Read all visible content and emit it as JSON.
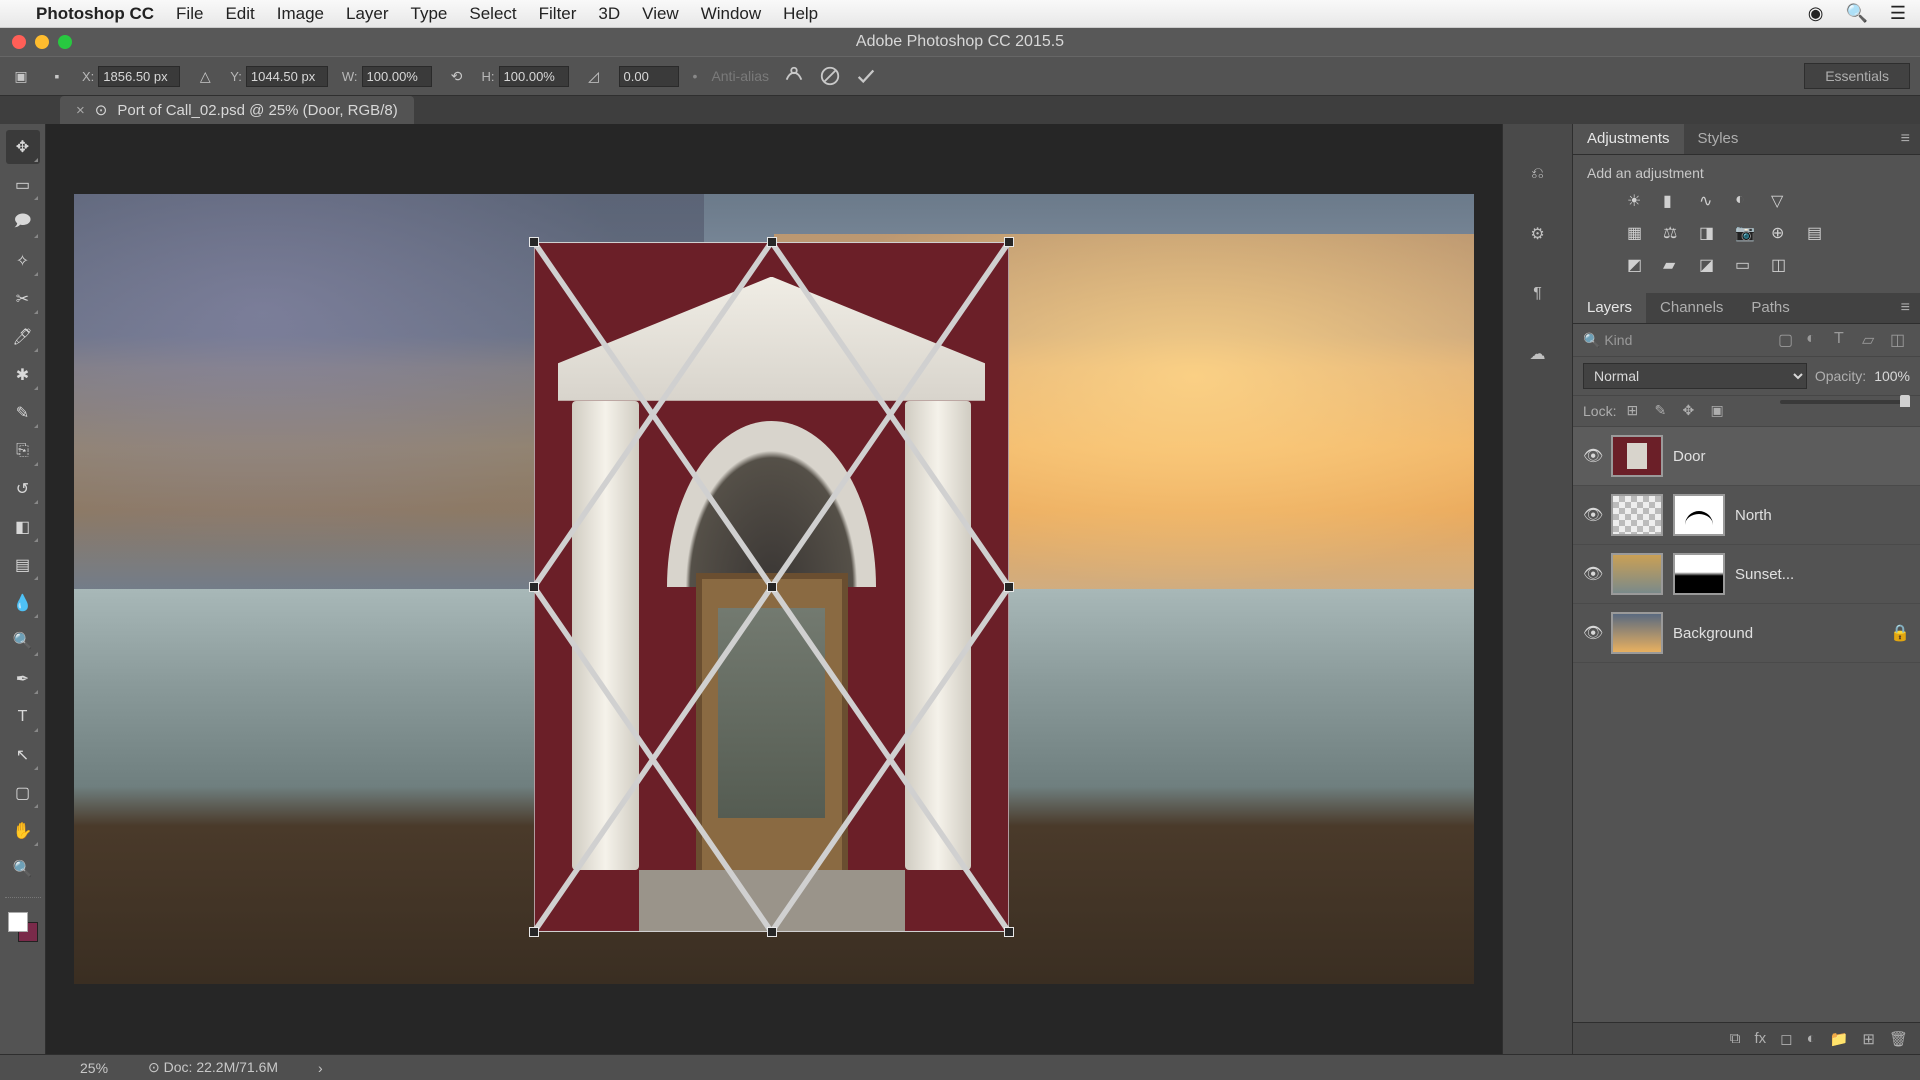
{
  "mac_menu": {
    "app_name": "Photoshop CC",
    "items": [
      "File",
      "Edit",
      "Image",
      "Layer",
      "Type",
      "Select",
      "Filter",
      "3D",
      "View",
      "Window",
      "Help"
    ]
  },
  "window_title": "Adobe Photoshop CC 2015.5",
  "options_bar": {
    "x_label": "X:",
    "x_value": "1856.50 px",
    "y_label": "Y:",
    "y_value": "1044.50 px",
    "w_label": "W:",
    "w_value": "100.00%",
    "h_label": "H:",
    "h_value": "100.00%",
    "angle_value": "0.00",
    "antialias": "Anti-alias",
    "workspace": "Essentials"
  },
  "doc_tab": {
    "title": "Port of Call_02.psd @ 25% (Door, RGB/8)"
  },
  "adjustments_panel": {
    "tab_adjustments": "Adjustments",
    "tab_styles": "Styles",
    "add_label": "Add an adjustment"
  },
  "layers_panel": {
    "tab_layers": "Layers",
    "tab_channels": "Channels",
    "tab_paths": "Paths",
    "search_placeholder": "Kind",
    "blend_mode": "Normal",
    "opacity_label": "Opacity:",
    "opacity_value": "100%",
    "lock_label": "Lock:",
    "layers": [
      {
        "name": "Door",
        "selected": true,
        "mask": false,
        "thumb": "door"
      },
      {
        "name": "North",
        "selected": false,
        "mask": "curve",
        "thumb": "checker"
      },
      {
        "name": "Sunset...",
        "selected": false,
        "mask": "grad",
        "thumb": "sunset"
      },
      {
        "name": "Background",
        "selected": false,
        "locked": true,
        "thumb": "sky"
      }
    ]
  },
  "status_bar": {
    "zoom": "25%",
    "doc_info": "Doc: 22.2M/71.6M"
  }
}
